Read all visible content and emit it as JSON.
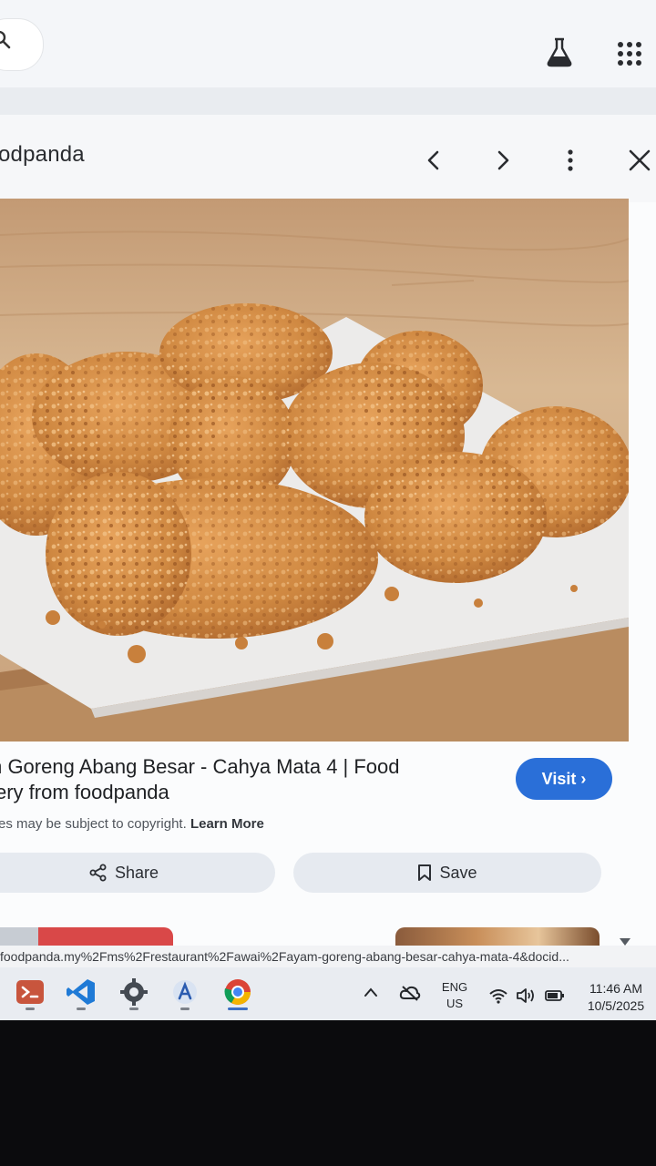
{
  "browser": {
    "search_icon": "search-icon",
    "labs_icon": "flask-icon",
    "apps_icon": "apps-grid-icon"
  },
  "viewer": {
    "source_name": "odpanda",
    "nav_icons": [
      "chevron-left-icon",
      "chevron-right-icon",
      "more-vert-icon",
      "close-icon"
    ],
    "image_title_line1": "m Goreng Abang Besar - Cahya Mata 4 | Food",
    "image_title_line2": "very from foodpanda",
    "visit_label": "Visit",
    "copyright_text": "es may be subject to copyright.",
    "learn_more_label": "Learn More",
    "share_label": "Share",
    "save_label": "Save",
    "accent_color": "#2a6fd8"
  },
  "status_bar": {
    "url": "foodpanda.my%2Fms%2Frestaurant%2Fawai%2Fayam-goreng-abang-besar-cahya-mata-4&docid..."
  },
  "taskbar": {
    "apps": [
      "terminal-app-icon",
      "vscode-icon",
      "settings-gear-icon",
      "store-icon",
      "chrome-icon"
    ],
    "language_line1": "ENG",
    "language_line2": "US",
    "time": "11:46 AM",
    "date": "10/5/2025"
  }
}
